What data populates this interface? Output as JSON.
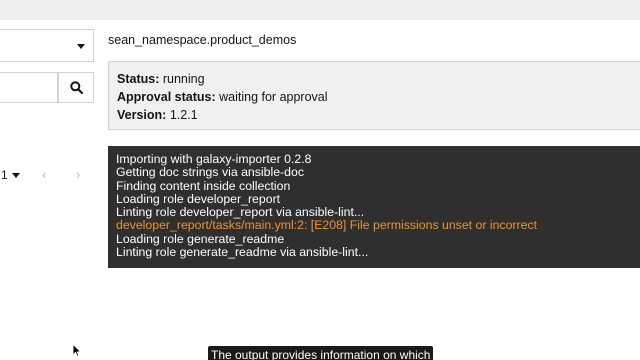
{
  "left_panel": {
    "select_value": "",
    "search_placeholder": "",
    "pagination": {
      "page": "1",
      "prev_icon": "chevron-left-icon",
      "next_icon": "chevron-right-icon"
    }
  },
  "header": {
    "namespace_title": "sean_namespace.product_demos"
  },
  "status": {
    "status_label": "Status:",
    "status_value": "running",
    "approval_label": "Approval status:",
    "approval_value": "waiting for approval",
    "version_label": "Version:",
    "version_value": "1.2.1"
  },
  "log": {
    "lines": [
      "Importing with galaxy-importer 0.2.8",
      "Getting doc strings via ansible-doc",
      "Finding content inside collection",
      "Loading role developer_report",
      "Linting role developer_report via ansible-lint...",
      "developer_report/tasks/main.yml:2: [E208] File permissions unset or incorrect",
      "Loading role generate_readme",
      "Linting role generate_readme via ansible-lint..."
    ],
    "warning_color": "#ef9234"
  },
  "caption": {
    "text": "The output provides information on which"
  }
}
